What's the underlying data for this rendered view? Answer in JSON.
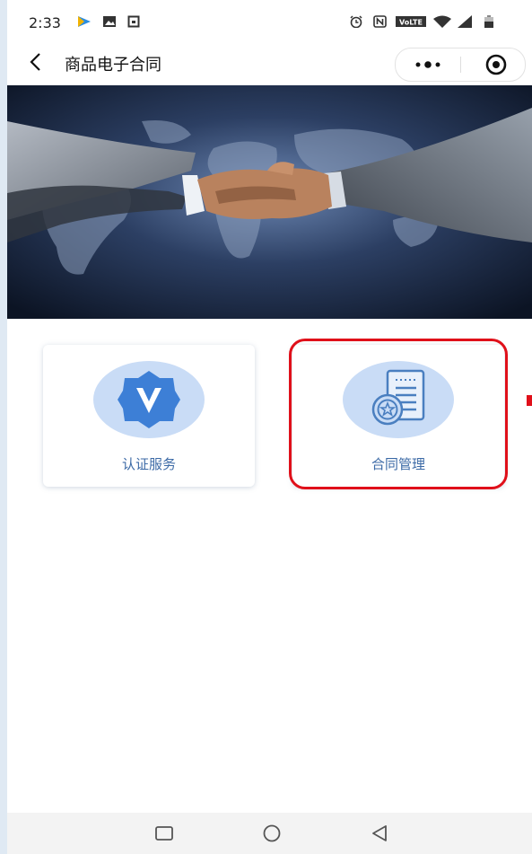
{
  "status_bar": {
    "time": "2:33",
    "network_label": "VoLTE",
    "icons": [
      "play-store-icon",
      "image-icon",
      "notification-icon",
      "alarm-icon",
      "nfc-icon",
      "volte-icon",
      "wifi-icon",
      "signal-icon",
      "battery-icon"
    ]
  },
  "header": {
    "title": "商品电子合同",
    "back_icon": "back-arrow-icon",
    "more_icon": "more-dots-icon",
    "close_icon": "target-close-icon"
  },
  "banner": {
    "description_icon": "handshake-world-map-banner"
  },
  "cards": [
    {
      "label": "认证服务",
      "icon": "verified-v-badge-icon",
      "color": "#3d7fd6"
    },
    {
      "label": "合同管理",
      "icon": "contract-document-icon",
      "color": "#4a7fc0",
      "highlighted": true
    }
  ],
  "highlight_color": "#e0101a",
  "nav_bar": {
    "icons": [
      "recent-apps-icon",
      "home-icon",
      "back-triangle-icon"
    ]
  }
}
